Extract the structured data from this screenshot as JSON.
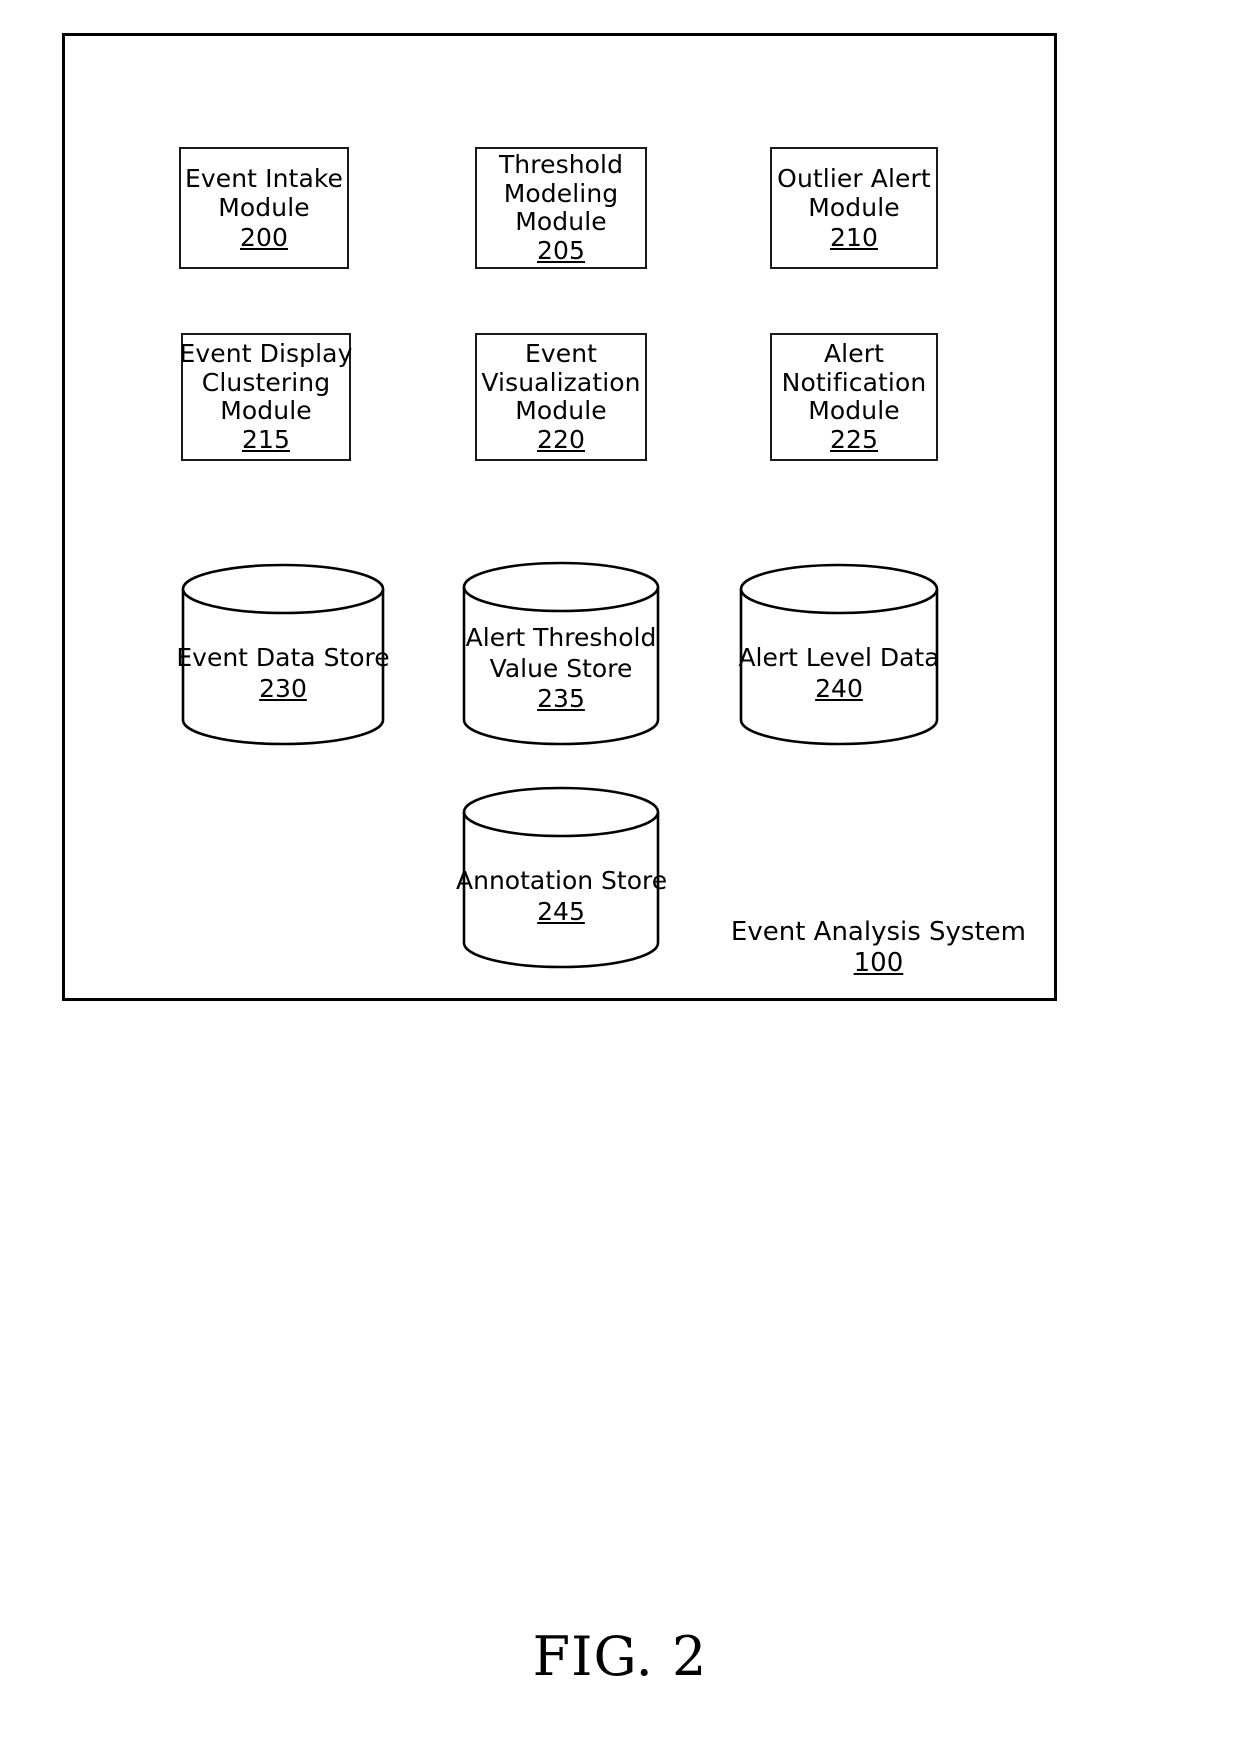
{
  "figure": {
    "caption": "FIG. 2"
  },
  "system": {
    "label": "Event Analysis System",
    "ref": "100"
  },
  "modules": [
    {
      "lines": [
        "Event Intake",
        "Module"
      ],
      "ref": "200",
      "name": "event-intake-module"
    },
    {
      "lines": [
        "Threshold",
        "Modeling",
        "Module"
      ],
      "ref": "205",
      "name": "threshold-modeling-module"
    },
    {
      "lines": [
        "Outlier Alert",
        "Module"
      ],
      "ref": "210",
      "name": "outlier-alert-module"
    },
    {
      "lines": [
        "Event Display",
        "Clustering",
        "Module"
      ],
      "ref": "215",
      "name": "event-display-clustering-module"
    },
    {
      "lines": [
        "Event",
        "Visualization",
        "Module"
      ],
      "ref": "220",
      "name": "event-visualization-module"
    },
    {
      "lines": [
        "Alert",
        "Notification",
        "Module"
      ],
      "ref": "225",
      "name": "alert-notification-module"
    }
  ],
  "datastores": [
    {
      "lines": [
        "Event Data Store"
      ],
      "ref": "230",
      "name": "event-data-store"
    },
    {
      "lines": [
        "Alert Threshold",
        "Value Store"
      ],
      "ref": "235",
      "name": "alert-threshold-value-store"
    },
    {
      "lines": [
        "Alert Level Data"
      ],
      "ref": "240",
      "name": "alert-level-data-store"
    },
    {
      "lines": [
        "Annotation Store"
      ],
      "ref": "245",
      "name": "annotation-store"
    }
  ],
  "colors": {
    "stroke": "#000000",
    "fill": "#ffffff",
    "text": "#000000"
  }
}
